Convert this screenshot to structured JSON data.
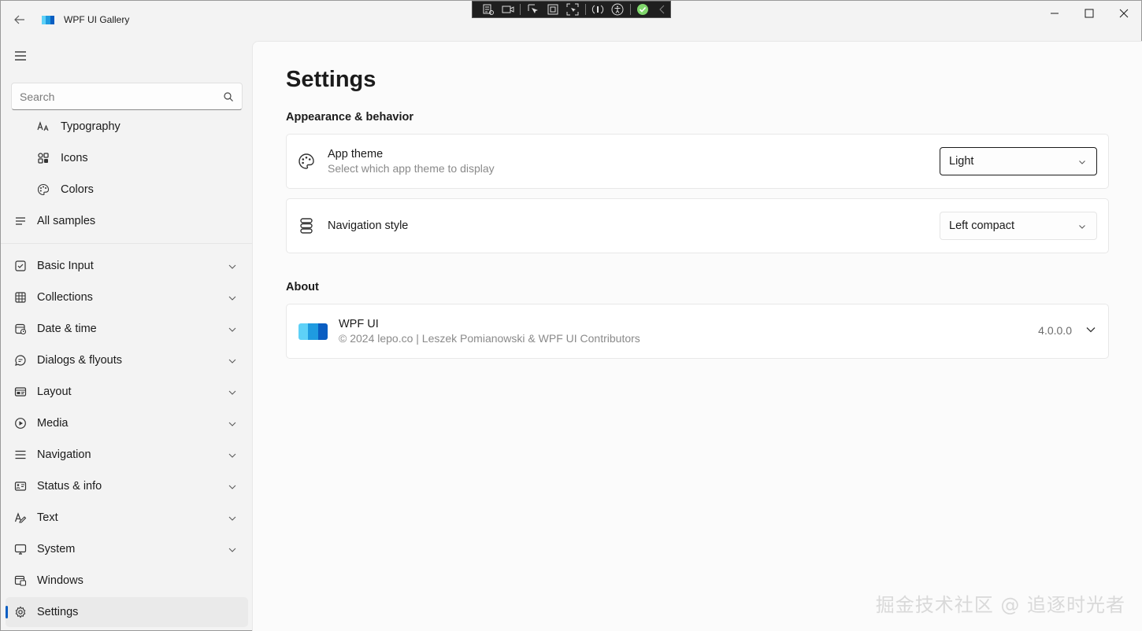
{
  "window": {
    "title": "WPF UI Gallery",
    "accent_color": "#0a5ec2"
  },
  "search": {
    "placeholder": "Search",
    "value": ""
  },
  "sidebar": {
    "sub_items": [
      {
        "label": "Typography",
        "icon": "typography-icon"
      },
      {
        "label": "Icons",
        "icon": "icons-icon"
      },
      {
        "label": "Colors",
        "icon": "palette-icon"
      }
    ],
    "all_samples": {
      "label": "All samples",
      "icon": "list-icon"
    },
    "items": [
      {
        "label": "Basic Input",
        "icon": "checkbox-icon"
      },
      {
        "label": "Collections",
        "icon": "grid-icon"
      },
      {
        "label": "Date & time",
        "icon": "calendar-clock-icon"
      },
      {
        "label": "Dialogs & flyouts",
        "icon": "chat-bubble-icon"
      },
      {
        "label": "Layout",
        "icon": "layout-icon"
      },
      {
        "label": "Media",
        "icon": "play-circle-icon"
      },
      {
        "label": "Navigation",
        "icon": "navigation-icon"
      },
      {
        "label": "Status & info",
        "icon": "status-icon"
      },
      {
        "label": "Text",
        "icon": "text-pen-icon"
      },
      {
        "label": "System",
        "icon": "monitor-icon"
      },
      {
        "label": "Windows",
        "icon": "windows-icon"
      },
      {
        "label": "Settings",
        "icon": "gear-icon",
        "selected": true
      }
    ]
  },
  "main": {
    "title": "Settings",
    "appearance": {
      "heading": "Appearance & behavior",
      "theme": {
        "title": "App theme",
        "subtitle": "Select which app theme to display",
        "value": "Light"
      },
      "navigation": {
        "title": "Navigation style",
        "value": "Left compact"
      }
    },
    "about": {
      "heading": "About",
      "name": "WPF UI",
      "copyright": "© 2024 lepo.co | Leszek Pomianowski & WPF UI Contributors",
      "version": "4.0.0.0"
    }
  },
  "watermark": "掘金技术社区 @ 追逐时光者"
}
